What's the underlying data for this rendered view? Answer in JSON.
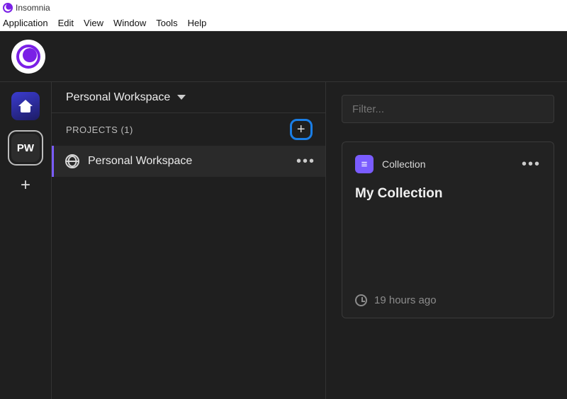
{
  "window": {
    "title": "Insomnia"
  },
  "menubar": {
    "items": [
      "Application",
      "Edit",
      "View",
      "Window",
      "Tools",
      "Help"
    ]
  },
  "rail": {
    "home_label": "Home",
    "workspace_badge": "PW",
    "add_tooltip": "+"
  },
  "sidebar": {
    "workspace_name": "Personal Workspace",
    "projects_header": "PROJECTS (1)",
    "project": {
      "name": "Personal Workspace"
    }
  },
  "content": {
    "filter_placeholder": "Filter...",
    "card": {
      "type_label": "Collection",
      "title": "My Collection",
      "timestamp": "19 hours ago"
    }
  },
  "colors": {
    "accent": "#7a5cff",
    "brand": "#7a20e6",
    "highlight": "#1a7ee6",
    "bg": "#1f1f1f"
  }
}
